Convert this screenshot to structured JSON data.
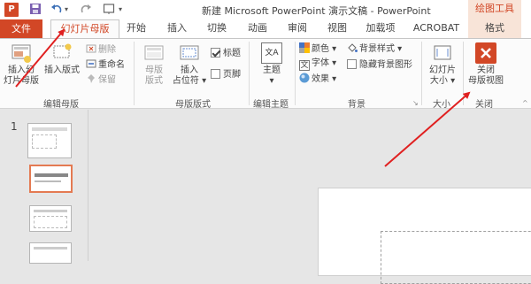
{
  "titlebar": {
    "logo": "P",
    "save_icon": "save-icon",
    "undo_icon": "undo-icon",
    "title": "新建 Microsoft PowerPoint 演示文稿 - PowerPoint",
    "context_title": "绘图工具"
  },
  "tabs": [
    {
      "label": "文件"
    },
    {
      "label": "幻灯片母版"
    },
    {
      "label": "开始"
    },
    {
      "label": "插入"
    },
    {
      "label": "切换"
    },
    {
      "label": "动画"
    },
    {
      "label": "审阅"
    },
    {
      "label": "视图"
    },
    {
      "label": "加载项"
    },
    {
      "label": "ACROBAT"
    },
    {
      "label": "格式"
    }
  ],
  "ribbon": {
    "edit_master": {
      "insert_master_1": "插入幻",
      "insert_master_2": "灯片母版",
      "insert_layout": "插入版式",
      "delete": "删除",
      "rename": "重命名",
      "preserve": "保留",
      "label": "编辑母版"
    },
    "master_layout": {
      "master_layout_1": "母版",
      "master_layout_2": "版式",
      "insert_placeholder_1": "插入",
      "insert_placeholder_2": "占位符",
      "title_check": "标题",
      "footer_check": "页脚",
      "label": "母版版式"
    },
    "edit_theme": {
      "theme": "主题",
      "theme_glyph": "文A",
      "label": "编辑主题"
    },
    "background": {
      "colors": "颜色",
      "fonts": "字体",
      "effects": "效果",
      "bg_styles": "背景样式",
      "hide_bg": "隐藏背景图形",
      "label": "背景"
    },
    "size": {
      "slide_size_1": "幻灯片",
      "slide_size_2": "大小",
      "label": "大小"
    },
    "close": {
      "close_1": "关闭",
      "close_2": "母版视图",
      "label": "关闭"
    }
  },
  "slides_pane": {
    "slide_number": "1"
  },
  "colors": {
    "accent": "#d24726",
    "annotation_arrow": "#e02020",
    "selected_thumb": "#e47a52"
  }
}
